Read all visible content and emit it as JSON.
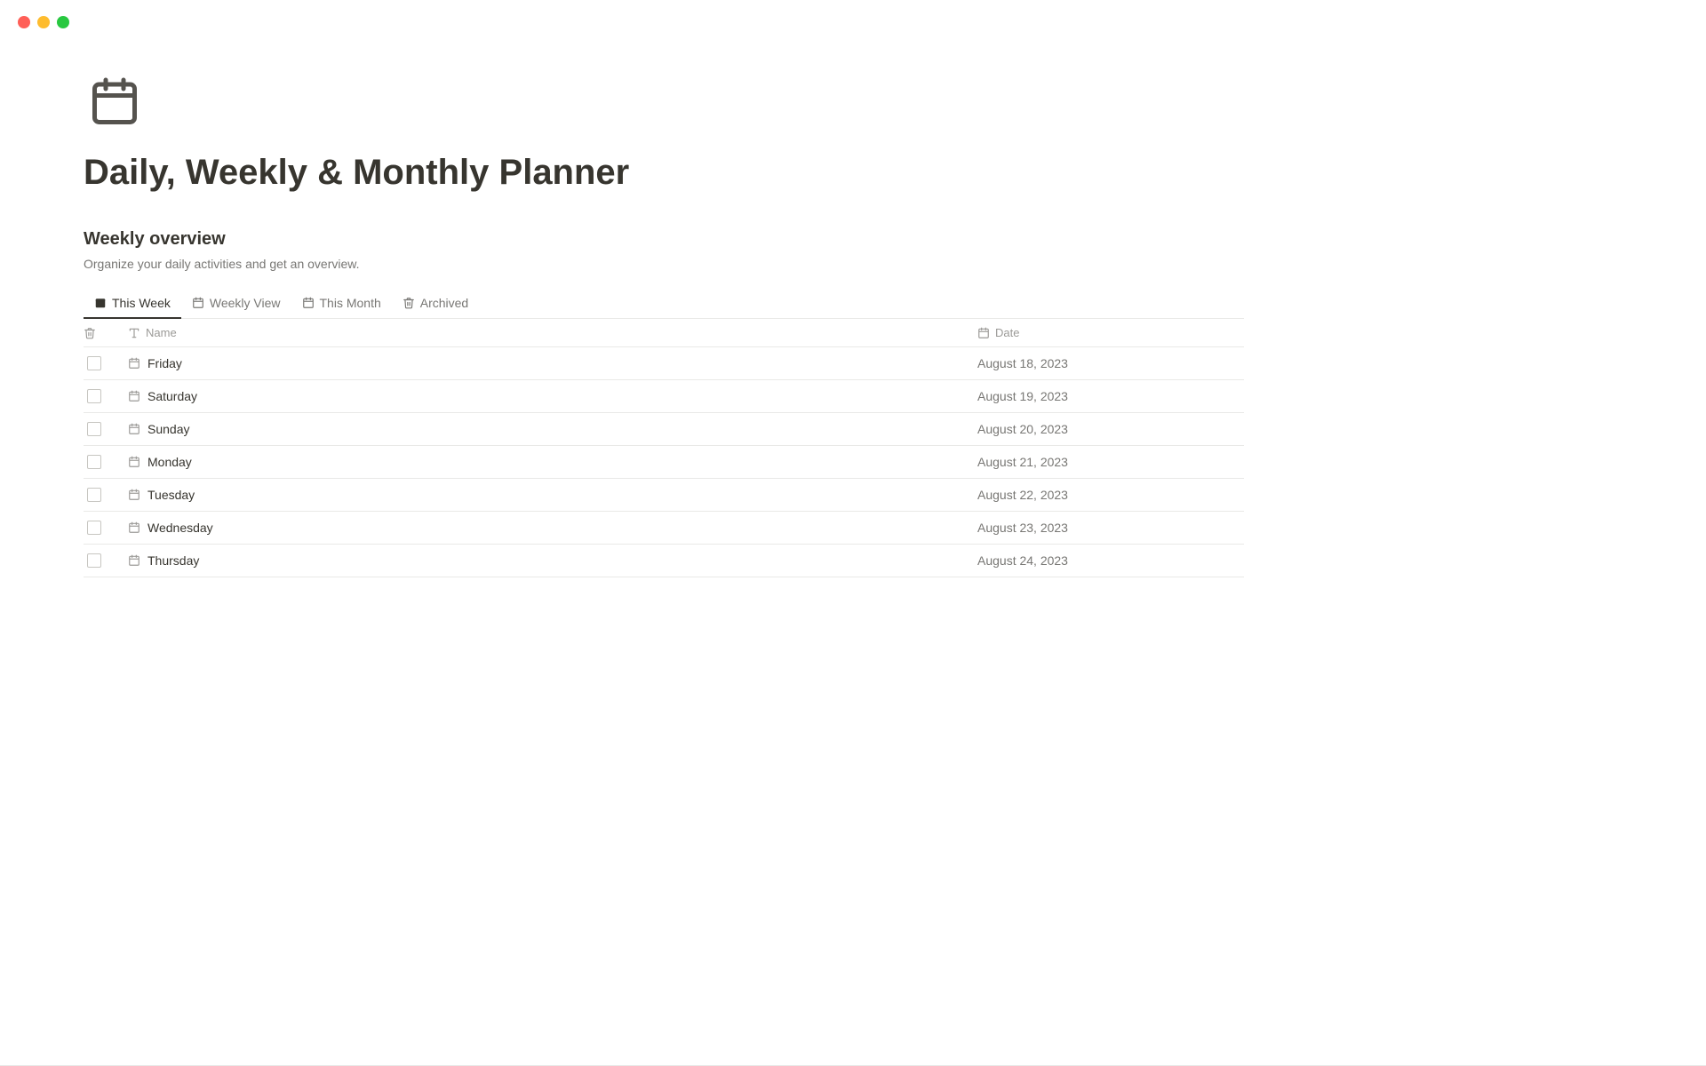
{
  "window": {
    "title": "Daily, Weekly & Monthly Planner"
  },
  "page": {
    "title": "Daily, Weekly & Monthly Planner",
    "icon_label": "calendar-icon"
  },
  "section": {
    "title": "Weekly overview",
    "description": "Organize your daily activities and get an overview."
  },
  "tabs": [
    {
      "id": "this-week",
      "label": "This Week",
      "icon": "calendar-filled-icon",
      "active": true
    },
    {
      "id": "weekly-view",
      "label": "Weekly View",
      "icon": "calendar-icon",
      "active": false
    },
    {
      "id": "this-month",
      "label": "This Month",
      "icon": "calendar-icon",
      "active": false
    },
    {
      "id": "archived",
      "label": "Archived",
      "icon": "trash-icon",
      "active": false
    }
  ],
  "table": {
    "columns": [
      {
        "id": "delete",
        "label": ""
      },
      {
        "id": "name",
        "label": "Name"
      },
      {
        "id": "date",
        "label": "Date"
      }
    ],
    "rows": [
      {
        "id": 1,
        "name": "Friday",
        "date": "August 18, 2023",
        "checked": false
      },
      {
        "id": 2,
        "name": "Saturday",
        "date": "August 19, 2023",
        "checked": false
      },
      {
        "id": 3,
        "name": "Sunday",
        "date": "August 20, 2023",
        "checked": false
      },
      {
        "id": 4,
        "name": "Monday",
        "date": "August 21, 2023",
        "checked": false
      },
      {
        "id": 5,
        "name": "Tuesday",
        "date": "August 22, 2023",
        "checked": false
      },
      {
        "id": 6,
        "name": "Wednesday",
        "date": "August 23, 2023",
        "checked": false
      },
      {
        "id": 7,
        "name": "Thursday",
        "date": "August 24, 2023",
        "checked": false
      }
    ]
  }
}
